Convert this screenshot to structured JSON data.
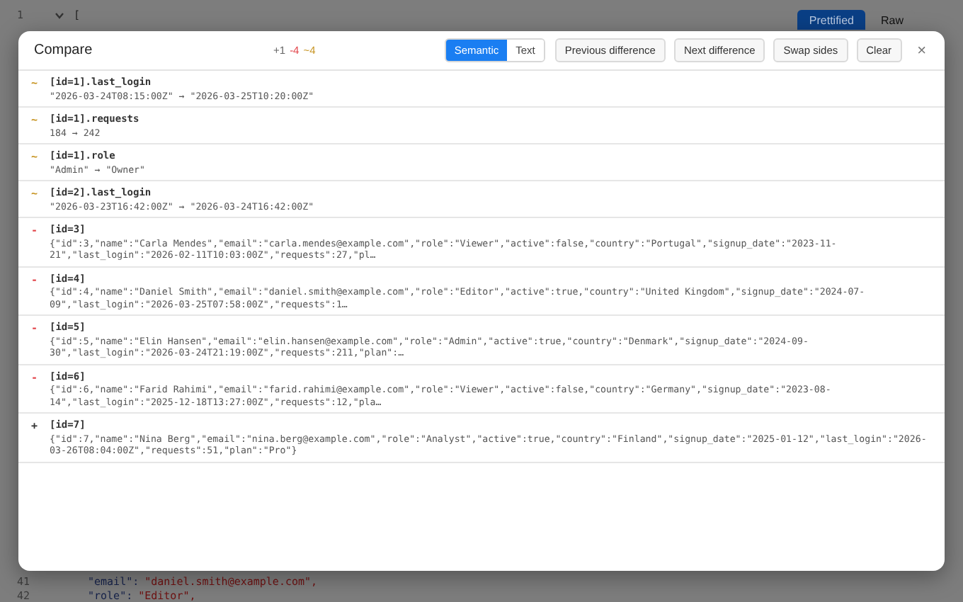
{
  "editor": {
    "top_lines": [
      {
        "number": "1",
        "fold": true,
        "text": "["
      }
    ],
    "view_buttons": [
      {
        "label": "Prettified",
        "selected": true
      },
      {
        "label": "Raw",
        "selected": false
      }
    ],
    "bottom_lines": [
      {
        "number": "41",
        "key": "\"email\":",
        "value": "\"daniel.smith@example.com\","
      },
      {
        "number": "42",
        "key": "\"role\":",
        "value": "\"Editor\","
      }
    ]
  },
  "dialog": {
    "title": "Compare",
    "summary": [
      {
        "kind": "added",
        "text": "+1"
      },
      {
        "kind": "removed",
        "text": "-4"
      },
      {
        "kind": "changed",
        "text": "~4"
      }
    ],
    "modes": [
      {
        "label": "Semantic",
        "selected": true
      },
      {
        "label": "Text",
        "selected": false
      }
    ],
    "actions": [
      "Previous difference",
      "Next difference",
      "Swap sides",
      "Clear"
    ],
    "close": "×",
    "diffs": [
      {
        "kind": "changed",
        "marker": "~",
        "path": "[id=1].last_login",
        "value": "\"2026-03-24T08:15:00Z\" → \"2026-03-25T10:20:00Z\""
      },
      {
        "kind": "changed",
        "marker": "~",
        "path": "[id=1].requests",
        "value": "184 → 242"
      },
      {
        "kind": "changed",
        "marker": "~",
        "path": "[id=1].role",
        "value": "\"Admin\" → \"Owner\""
      },
      {
        "kind": "changed",
        "marker": "~",
        "path": "[id=2].last_login",
        "value": "\"2026-03-23T16:42:00Z\" → \"2026-03-24T16:42:00Z\""
      },
      {
        "kind": "removed",
        "marker": "-",
        "path": "[id=3]",
        "value": "{\"id\":3,\"name\":\"Carla Mendes\",\"email\":\"carla.mendes@example.com\",\"role\":\"Viewer\",\"active\":false,\"country\":\"Portugal\",\"signup_date\":\"2023-11-21\",\"last_login\":\"2026-02-11T10:03:00Z\",\"requests\":27,\"pl…"
      },
      {
        "kind": "removed",
        "marker": "-",
        "path": "[id=4]",
        "value": "{\"id\":4,\"name\":\"Daniel Smith\",\"email\":\"daniel.smith@example.com\",\"role\":\"Editor\",\"active\":true,\"country\":\"United Kingdom\",\"signup_date\":\"2024-07-09\",\"last_login\":\"2026-03-25T07:58:00Z\",\"requests\":1…"
      },
      {
        "kind": "removed",
        "marker": "-",
        "path": "[id=5]",
        "value": "{\"id\":5,\"name\":\"Elin Hansen\",\"email\":\"elin.hansen@example.com\",\"role\":\"Admin\",\"active\":true,\"country\":\"Denmark\",\"signup_date\":\"2024-09-30\",\"last_login\":\"2026-03-24T21:19:00Z\",\"requests\":211,\"plan\":…"
      },
      {
        "kind": "removed",
        "marker": "-",
        "path": "[id=6]",
        "value": "{\"id\":6,\"name\":\"Farid Rahimi\",\"email\":\"farid.rahimi@example.com\",\"role\":\"Viewer\",\"active\":false,\"country\":\"Germany\",\"signup_date\":\"2023-08-14\",\"last_login\":\"2025-12-18T13:27:00Z\",\"requests\":12,\"pla…"
      },
      {
        "kind": "added",
        "marker": "+",
        "path": "[id=7]",
        "value": "{\"id\":7,\"name\":\"Nina Berg\",\"email\":\"nina.berg@example.com\",\"role\":\"Analyst\",\"active\":true,\"country\":\"Finland\",\"signup_date\":\"2025-01-12\",\"last_login\":\"2026-03-26T08:04:00Z\",\"requests\":51,\"plan\":\"Pro\"}"
      }
    ]
  }
}
